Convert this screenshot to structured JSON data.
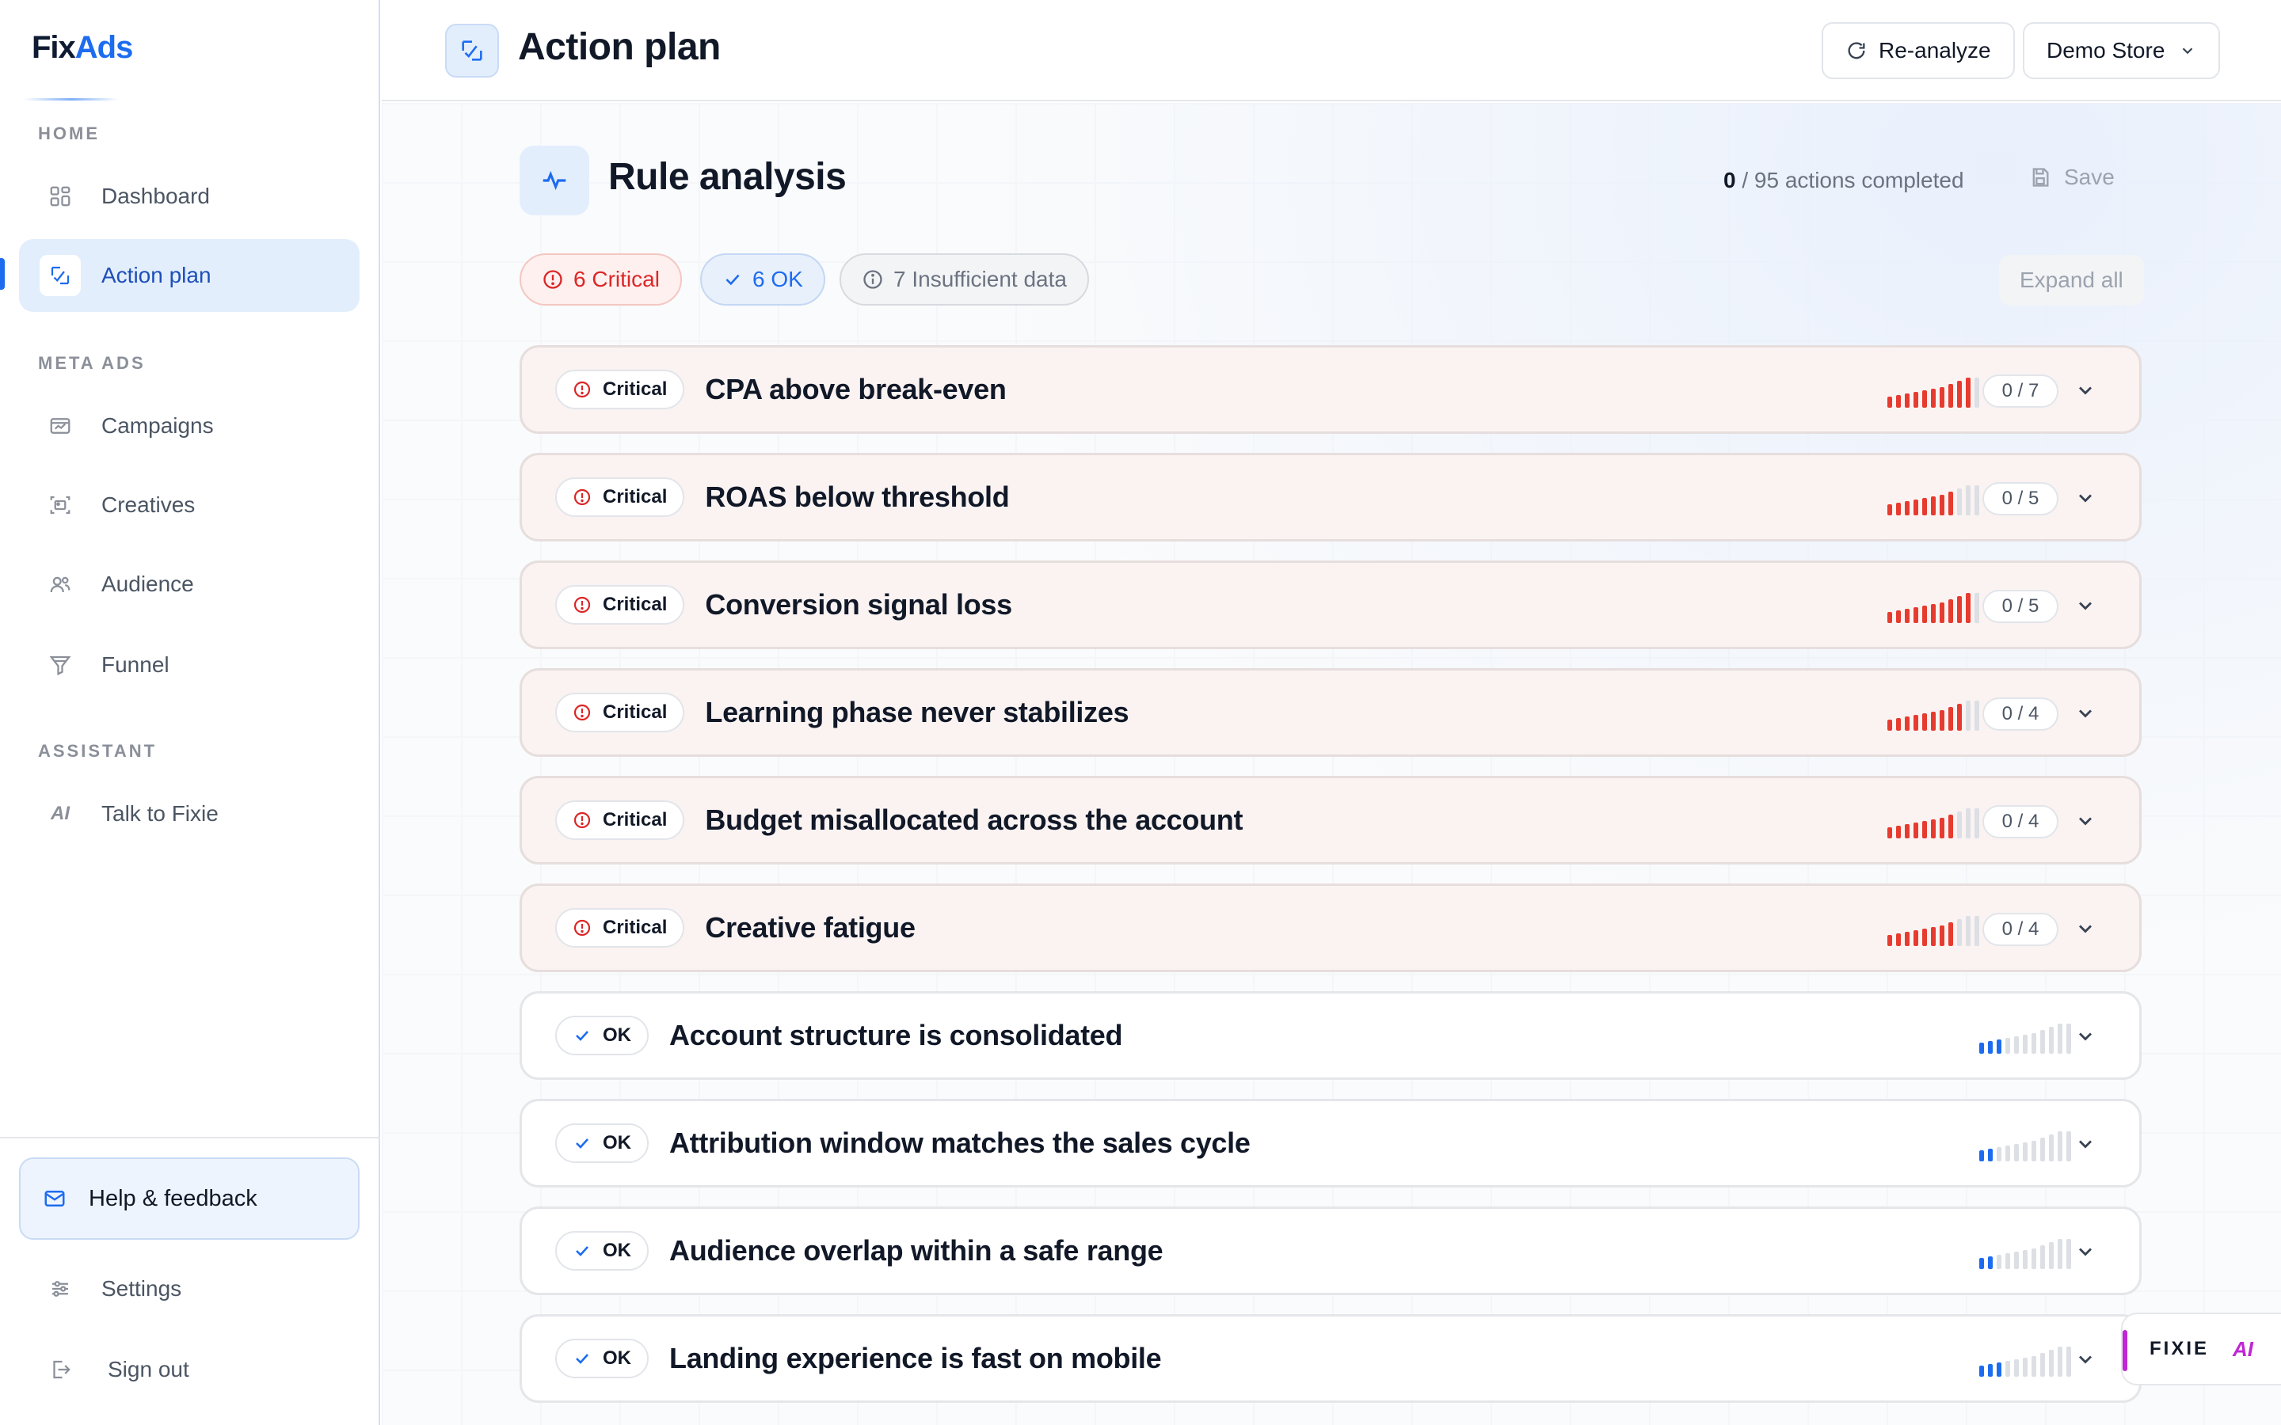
{
  "app": {
    "logo_part1": "Fix",
    "logo_part2": "Ads"
  },
  "sidebar": {
    "section_home": "HOME",
    "section_meta": "META ADS",
    "section_assistant": "ASSISTANT",
    "items": [
      {
        "label": "Dashboard",
        "icon": "dashboard-icon"
      },
      {
        "label": "Action plan",
        "icon": "action-plan-icon",
        "active": true
      },
      {
        "label": "Campaigns",
        "icon": "campaigns-icon"
      },
      {
        "label": "Creatives",
        "icon": "creatives-icon"
      },
      {
        "label": "Audience",
        "icon": "audience-icon"
      },
      {
        "label": "Funnel",
        "icon": "funnel-icon"
      },
      {
        "label": "Talk to Fixie",
        "icon": "ai-icon",
        "glyph": "AI"
      }
    ],
    "help_label": "Help & feedback",
    "settings_label": "Settings",
    "signout_label": "Sign out"
  },
  "header": {
    "title": "Action plan",
    "reanalyze_label": "Re-analyze",
    "store_label": "Demo Store"
  },
  "main": {
    "section_title": "Rule analysis",
    "completed_count": "0",
    "completed_rest": " / 95 actions completed",
    "save_label": "Save",
    "filters": {
      "critical": "6 Critical",
      "ok": "6 OK",
      "insufficient": "7 Insufficient data"
    },
    "expand_all_label": "Expand all"
  },
  "colors": {
    "accent": "#1d6cf0",
    "critical": "#dc2626",
    "critical_bar": "#e63b2e",
    "ok_bar": "#1d6cf0",
    "inactive_bar": "#dcdfe4",
    "ai": "#c026d3"
  },
  "rules": [
    {
      "status": "Critical",
      "title": "CPA above break-even",
      "count": "0 / 7",
      "level": 10
    },
    {
      "status": "Critical",
      "title": "ROAS below threshold",
      "count": "0 / 5",
      "level": 8
    },
    {
      "status": "Critical",
      "title": "Conversion signal loss",
      "count": "0 / 5",
      "level": 10
    },
    {
      "status": "Critical",
      "title": "Learning phase never stabilizes",
      "count": "0 / 4",
      "level": 9
    },
    {
      "status": "Critical",
      "title": "Budget misallocated across the account",
      "count": "0 / 4",
      "level": 8
    },
    {
      "status": "Critical",
      "title": "Creative fatigue",
      "count": "0 / 4",
      "level": 8
    },
    {
      "status": "OK",
      "title": "Account structure is consolidated",
      "count": null,
      "level": 3
    },
    {
      "status": "OK",
      "title": "Attribution window matches the sales cycle",
      "count": null,
      "level": 2
    },
    {
      "status": "OK",
      "title": "Audience overlap within a safe range",
      "count": null,
      "level": 2
    },
    {
      "status": "OK",
      "title": "Landing experience is fast on mobile",
      "count": null,
      "level": 3
    }
  ],
  "fixie": {
    "label": "FIXIE",
    "glyph": "AI"
  }
}
